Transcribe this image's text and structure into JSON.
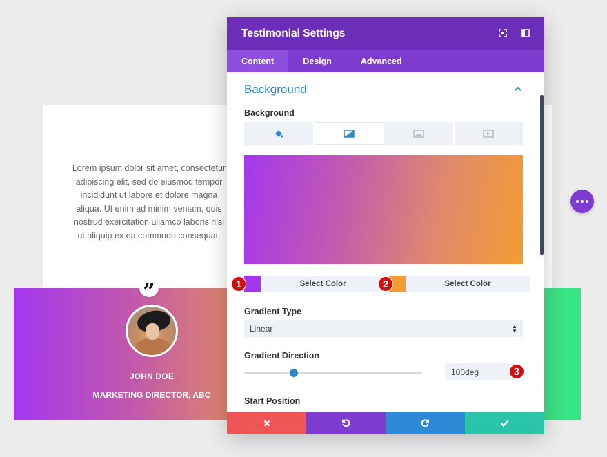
{
  "testimonial": {
    "body": "Lorem ipsum dolor sit amet, consectetur adipiscing elit, sed do eiusmod tempor incididunt ut labore et dolore magna aliqua. Ut enim ad minim veniam, quis nostrud exercitation ullamco laboris nisi ut aliquip ex ea commodo consequat.",
    "author_name": "JOHN DOE",
    "author_title": "MARKETING DIRECTOR, ABC"
  },
  "modal": {
    "title": "Testimonial Settings",
    "tabs": [
      {
        "label": "Content",
        "active": true
      },
      {
        "label": "Design",
        "active": false
      },
      {
        "label": "Advanced",
        "active": false
      }
    ],
    "section_title": "Background",
    "background_label": "Background",
    "background_types": [
      {
        "icon": "paint-bucket-icon",
        "active": false
      },
      {
        "icon": "gradient-icon",
        "active": true
      },
      {
        "icon": "image-icon",
        "active": false
      },
      {
        "icon": "video-icon",
        "active": false
      }
    ],
    "gradient": {
      "start_color": "#a437ee",
      "end_color": "#f39c33",
      "start_label": "Select Color",
      "end_label": "Select Color",
      "type_label": "Gradient Type",
      "type_value": "Linear",
      "direction_label": "Gradient Direction",
      "direction_value": "100deg",
      "direction_slider_fraction": 0.28,
      "start_position_label": "Start Position"
    },
    "markers": [
      "1",
      "2",
      "3"
    ]
  },
  "colors": {
    "header": "#6c2eb9",
    "tabs": "#7e3bd0",
    "accent_blue": "#2e89c6",
    "cancel": "#ef5555",
    "undo": "#7e3bd0",
    "redo": "#2e89d6",
    "save": "#29c4a9"
  }
}
